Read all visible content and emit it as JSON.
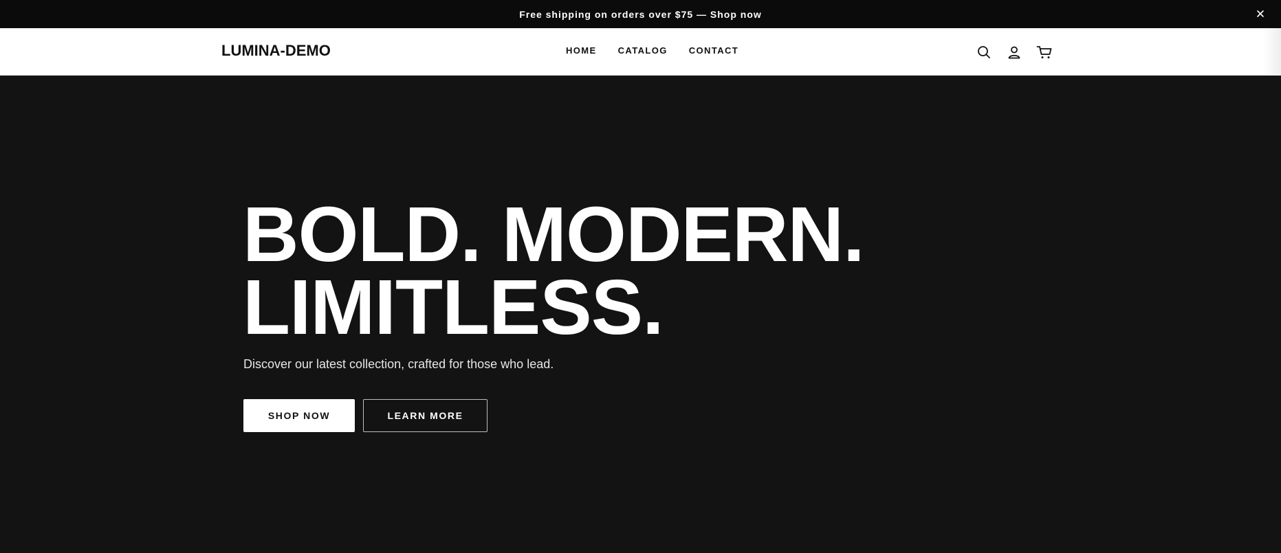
{
  "announcement": {
    "text": "Free shipping on orders over $75 — Shop now",
    "close_icon": "close-icon"
  },
  "header": {
    "logo": "LUMINA-DEMO",
    "nav": [
      "HOME",
      "CATALOG",
      "CONTACT"
    ],
    "icons": [
      "search-icon",
      "account-icon",
      "cart-icon"
    ]
  },
  "hero": {
    "title_line1": "BOLD. MODERN.",
    "title_line2": "LIMITLESS.",
    "subtitle": "Discover our latest collection, crafted for those who lead.",
    "primary_button": "SHOP NOW",
    "secondary_button": "LEARN MORE"
  },
  "colors": {
    "announcement_bg": "#0b0b0b",
    "header_bg": "#ffffff",
    "hero_bg": "#131313",
    "text_light": "#ffffff",
    "text_dark": "#111111"
  }
}
